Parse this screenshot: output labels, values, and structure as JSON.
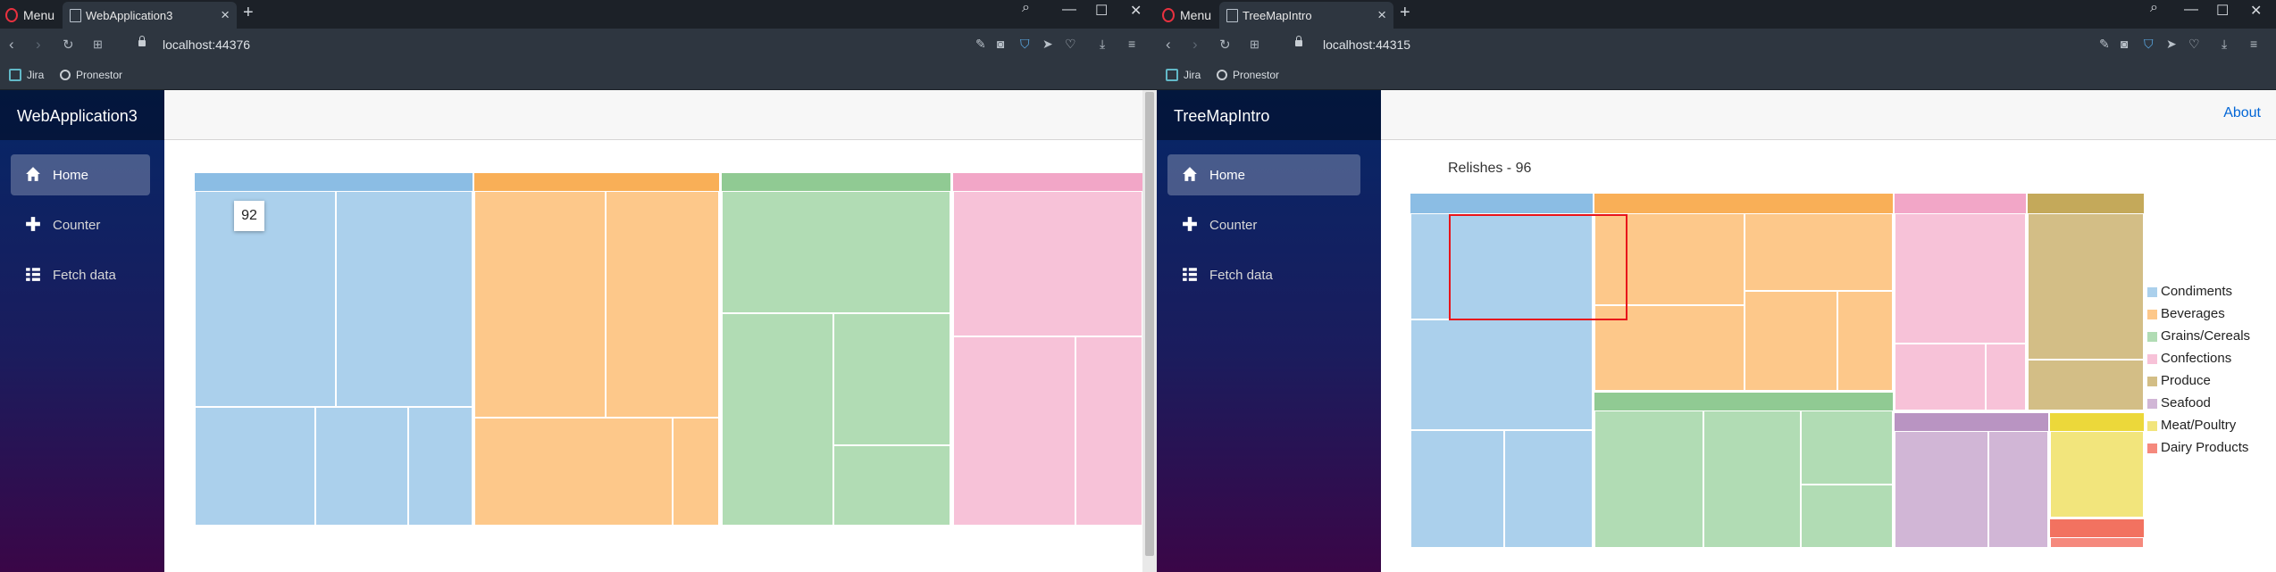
{
  "windows": [
    {
      "id": "A",
      "browser": {
        "menu_label": "Menu",
        "tab_title": "WebApplication3",
        "url": "localhost:44376",
        "bookmarks": [
          "Jira",
          "Pronestor"
        ]
      },
      "app": {
        "brand": "WebApplication3",
        "nav": [
          {
            "label": "Home",
            "icon": "home-icon",
            "active": true
          },
          {
            "label": "Counter",
            "icon": "plus-icon",
            "active": false
          },
          {
            "label": "Fetch data",
            "icon": "list-icon",
            "active": false
          }
        ]
      },
      "treemap": {
        "tooltip_value": "92"
      }
    },
    {
      "id": "B",
      "browser": {
        "menu_label": "Menu",
        "tab_title": "TreeMapIntro",
        "url": "localhost:44315",
        "bookmarks": [
          "Jira",
          "Pronestor"
        ]
      },
      "app": {
        "brand": "TreeMapIntro",
        "top_link": "About",
        "nav": [
          {
            "label": "Home",
            "icon": "home-icon",
            "active": true
          },
          {
            "label": "Counter",
            "icon": "plus-icon",
            "active": false
          },
          {
            "label": "Fetch data",
            "icon": "list-icon",
            "active": false
          }
        ]
      },
      "treemap": {
        "title": "Relishes - 96",
        "legend": [
          {
            "label": "Condiments",
            "color": "#abd0ec"
          },
          {
            "label": "Beverages",
            "color": "#fdc88a"
          },
          {
            "label": "Grains/Cereals",
            "color": "#b1dcb4"
          },
          {
            "label": "Confections",
            "color": "#f7c2d8"
          },
          {
            "label": "Produce",
            "color": "#d3be86"
          },
          {
            "label": "Seafood",
            "color": "#d1b6d6"
          },
          {
            "label": "Meat/Poultry",
            "color": "#f2e57c"
          },
          {
            "label": "Dairy Products",
            "color": "#f5897d"
          }
        ]
      }
    }
  ],
  "colors": {
    "Condiments": {
      "fill": "#abd0ec",
      "header": "#8bbde4"
    },
    "Beverages": {
      "fill": "#fdc88a",
      "header": "#f9af57"
    },
    "Grains/Cereals": {
      "fill": "#b1dcb4",
      "header": "#90ca93"
    },
    "Confections": {
      "fill": "#f7c2d8",
      "header": "#f2a6c7"
    },
    "Produce": {
      "fill": "#d3be86",
      "header": "#c4a95a"
    },
    "Seafood": {
      "fill": "#d1b6d6",
      "header": "#b994c2"
    },
    "Meat/Poultry": {
      "fill": "#f2e57c",
      "header": "#ecd83a"
    },
    "Dairy Products": {
      "fill": "#f5897d",
      "header": "#f27260"
    }
  }
}
